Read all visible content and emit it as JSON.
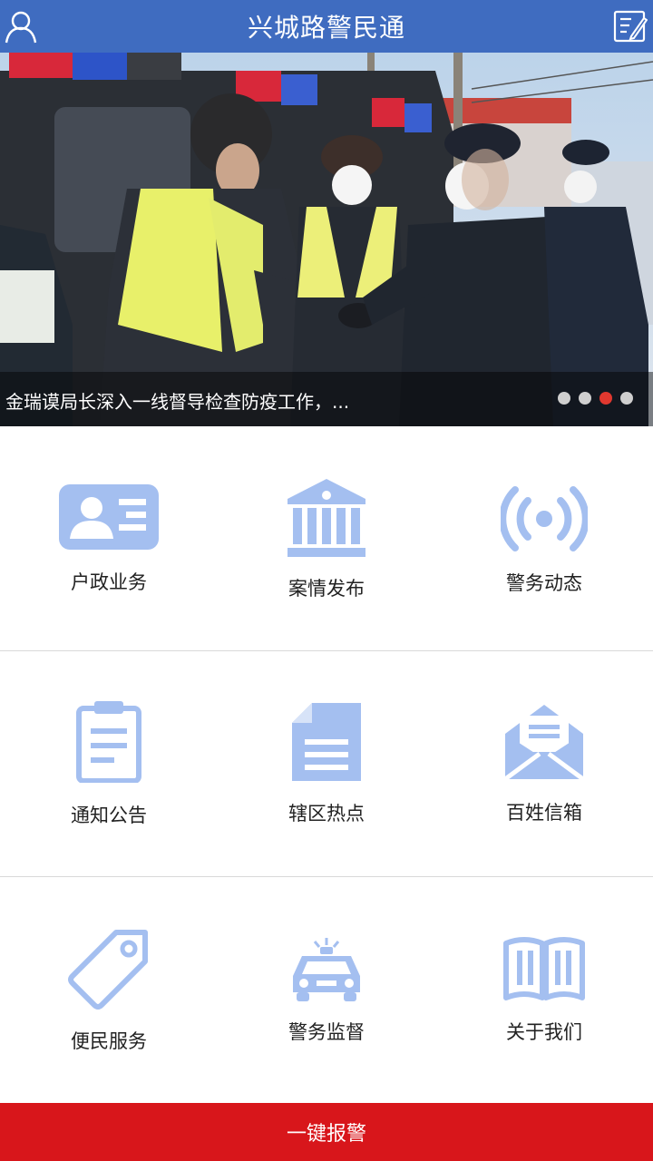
{
  "header": {
    "title": "兴城路警民通",
    "left_icon": "user-icon",
    "right_icon": "edit-note-icon"
  },
  "banner": {
    "caption": "金瑞谟局长深入一线督导检查防疫工作，...",
    "dot_count": 4,
    "active_dot": 3
  },
  "menu": [
    {
      "label": "户政业务",
      "icon": "id-card-icon"
    },
    {
      "label": "案情发布",
      "icon": "bank-building-icon"
    },
    {
      "label": "警务动态",
      "icon": "broadcast-icon"
    },
    {
      "label": "通知公告",
      "icon": "clipboard-icon"
    },
    {
      "label": "辖区热点",
      "icon": "document-icon"
    },
    {
      "label": "百姓信箱",
      "icon": "mail-icon"
    },
    {
      "label": "便民服务",
      "icon": "tag-icon"
    },
    {
      "label": "警务监督",
      "icon": "police-car-icon"
    },
    {
      "label": "关于我们",
      "icon": "open-book-icon"
    }
  ],
  "footer": {
    "alarm_label": "一键报警"
  },
  "colors": {
    "header_bg": "#3f6cc0",
    "icon_blue": "#a4bff0",
    "alarm_red": "#d8161b",
    "dot_active": "#e0382f"
  }
}
